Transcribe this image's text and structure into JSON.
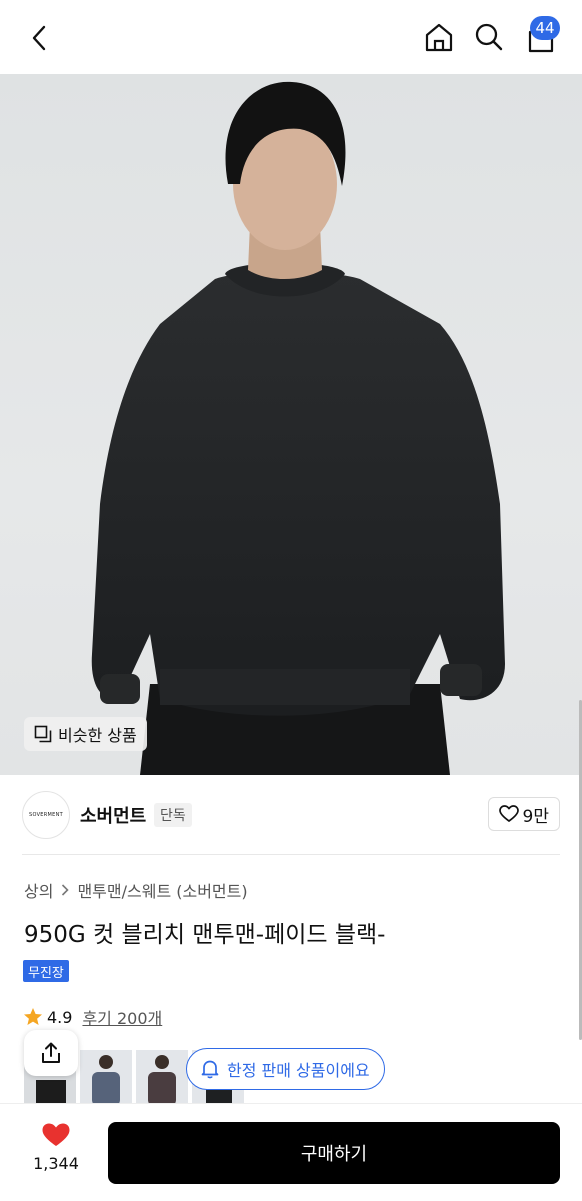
{
  "header": {
    "back_icon": "chevron-left-icon",
    "home_icon": "home-icon",
    "search_icon": "search-icon",
    "cart_icon": "cart-icon",
    "cart_count": "44"
  },
  "hero": {
    "similar_label": "비슷한 상품"
  },
  "brand": {
    "logo_text": "SOVERMENT",
    "name": "소버먼트",
    "exclusive_label": "단독",
    "likes": "9만"
  },
  "product": {
    "breadcrumb": [
      "상의",
      "맨투맨/스웨트 (소버먼트)"
    ],
    "title": "950G 컷 블리치 맨투맨-페이드 블랙-",
    "tag": "무진장",
    "rating": "4.9",
    "reviews": "후기 200개"
  },
  "floating": {
    "limited_label": "한정 판매 상품이에요"
  },
  "bottom": {
    "wish_count": "1,344",
    "buy_label": "구매하기"
  },
  "colors": {
    "accent": "#2f6ae6",
    "heart": "#e8322f",
    "star": "#f5a623",
    "buy_bg": "#000000"
  }
}
